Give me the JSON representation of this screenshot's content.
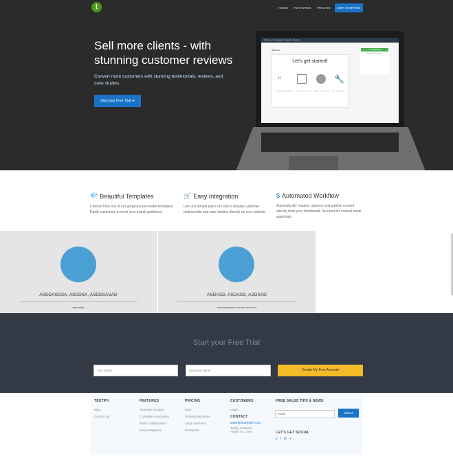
{
  "nav": {
    "logo_letter": "t",
    "items": [
      "HOME",
      "FEATURES",
      "PRICING"
    ],
    "cta": "GET STARTED"
  },
  "hero": {
    "title": "Sell more clients - with stunning customer reviews",
    "subtitle": "Convert more customers with stunning testimonials, reviews, and case studies.",
    "button": "Start your Free Trial"
  },
  "laptop_screen": {
    "tabs": [
      "Overview",
      "Your reviews",
      "Customize",
      "Reviews"
    ],
    "welcome": "Welcome",
    "heading": "Let's get started!",
    "steps": [
      "Customize your dashboard",
      "Write your first review",
      "Request more reviews",
      "Set up automation"
    ],
    "create_review": "+ Create Review",
    "download": "Download Testimonials"
  },
  "features": [
    {
      "icon": "diamond-icon",
      "glyph": "💎",
      "title": "Beautiful Templates",
      "text": "Choose from any of our gorgeous pre-made templates. Easily customize to meet your brand guidelines."
    },
    {
      "icon": "cart-icon",
      "glyph": "🛒",
      "title": "Easy Integration",
      "text": "Use one simple piece of code to display customer testimonials and case studies directly on your website."
    },
    {
      "icon": "dollar-icon",
      "glyph": "$",
      "title": "Automated Workflow",
      "text": "Automatically request, approve and publish content directly from your dashboard. No need for manual email approvals."
    }
  ],
  "cards": [
    {
      "name": "ASDDASDSA, ASDDSA, ASDDSASAD",
      "sub": "asdsadads"
    },
    {
      "name": "ASDASD, ASDADS, ASDSAD",
      "sub": "asdsdasdadsads asd asd asd asd sa"
    }
  ],
  "trial": {
    "title": "Start your Free Trial",
    "email_placeholder": "Your Email",
    "business_placeholder": "Business Name",
    "button": "Create My Free Account"
  },
  "footer": {
    "columns": [
      {
        "title": "TESTIFY",
        "items": [
          "Blog",
          "Contact Us"
        ]
      },
      {
        "title": "FEATURES",
        "items": [
          "Stunning Designs",
          "Complete Automation",
          "Team Collaboration",
          "Easy Integration"
        ]
      },
      {
        "title": "PRICING",
        "items": [
          "Solo",
          "Growing Business",
          "Large Business",
          "Enterprise"
        ]
      },
      {
        "title": "CUSTOMERS",
        "items": [
          "Login"
        ]
      }
    ],
    "contact_title": "CONTACT",
    "contact_email": "sales@testifywith.com",
    "contact_lines": [
      "Testify Software",
      "Austin TX, USA"
    ],
    "news_title": "FREE SALES TIPS & NEWS",
    "news_placeholder": "email",
    "news_button": "Submit",
    "social_title": "LET'S GET SOCIAL",
    "social_icons": [
      "twitter-icon",
      "facebook-icon",
      "google-plus-icon"
    ],
    "social_glyphs": "y f G+"
  },
  "colors": {
    "hero_bg": "#2b2b2b",
    "accent": "#1a73c6",
    "cta_yellow": "#f2bb27",
    "trial_bg": "#333a46",
    "circle": "#4aa0d5"
  }
}
